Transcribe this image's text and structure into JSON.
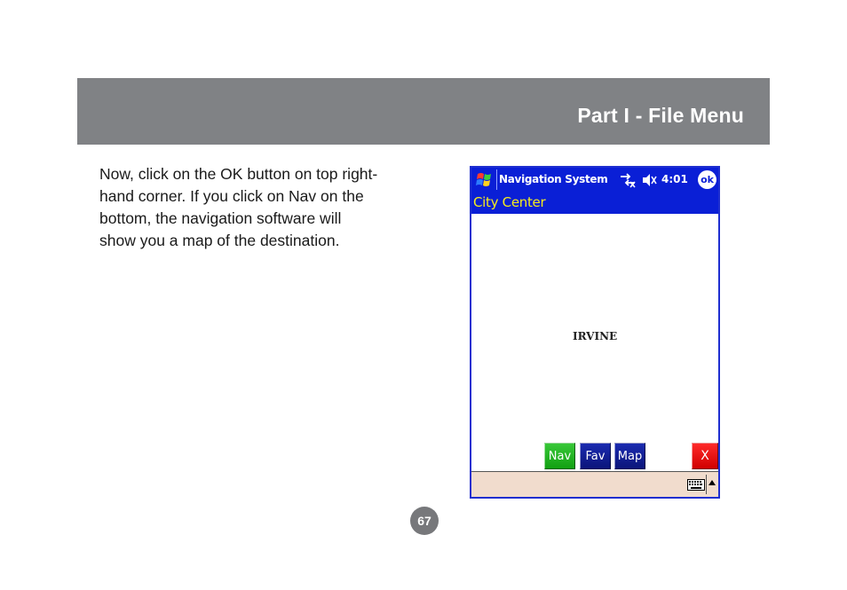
{
  "header": {
    "title": "Part I - File Menu",
    "background": "#808285"
  },
  "body": {
    "lines": [
      "Now, click on the OK button on top right-",
      "hand corner.  If you click on Nav on the",
      "bottom, the navigation software will",
      "show you a map of the destination."
    ]
  },
  "pda": {
    "taskbar": {
      "title": "Navigation System",
      "clock": "4:01",
      "ok_label": "ok",
      "start_icon": "windows-flag-icon",
      "connectivity_icon": "connectivity-icon",
      "volume_icon": "speaker-muted-icon"
    },
    "title_strip": "City Center",
    "map": {
      "city_label": "IRVINE"
    },
    "buttons": {
      "nav": "Nav",
      "fav": "Fav",
      "map": "Map",
      "close": "X"
    },
    "sip": {
      "keyboard_icon": "keyboard-icon",
      "arrow_icon": "up-arrow-icon"
    },
    "colors": {
      "taskbar": "#0a1fd6",
      "title_text": "#f5ec1e",
      "sip_bar": "#f1dccd"
    }
  },
  "footer": {
    "page_number": "67"
  }
}
